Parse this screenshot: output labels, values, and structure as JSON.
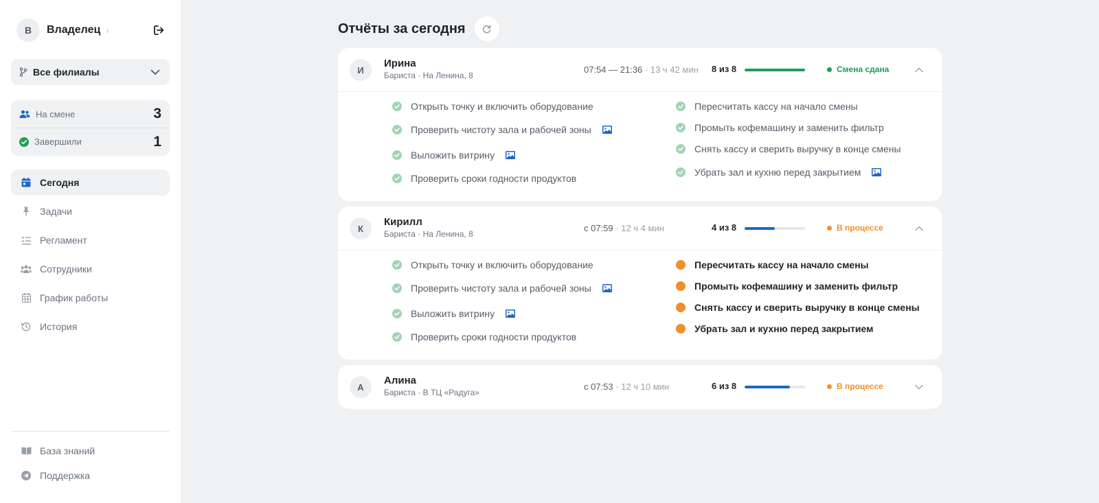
{
  "user": {
    "initial": "В",
    "name": "Владелец"
  },
  "branch": {
    "label": "Все филиалы"
  },
  "stats": [
    {
      "label": "На смене",
      "value": "3",
      "icon": "users-icon"
    },
    {
      "label": "Завершили",
      "value": "1",
      "icon": "check-circle-icon"
    }
  ],
  "nav": [
    {
      "label": "Сегодня",
      "icon": "calendar-icon",
      "active": true
    },
    {
      "label": "Задачи",
      "icon": "pin-icon",
      "active": false
    },
    {
      "label": "Регламент",
      "icon": "checklist-icon",
      "active": false
    },
    {
      "label": "Сотрудники",
      "icon": "users-icon",
      "active": false
    },
    {
      "label": "График работы",
      "icon": "calendar-grid-icon",
      "active": false
    },
    {
      "label": "История",
      "icon": "history-icon",
      "active": false
    }
  ],
  "nav_bottom": [
    {
      "label": "База знаний",
      "icon": "book-icon"
    },
    {
      "label": "Поддержка",
      "icon": "send-icon"
    }
  ],
  "page": {
    "title": "Отчёты за сегодня"
  },
  "colors": {
    "done": "#1e9e57",
    "in_progress": "#f18f2d",
    "progress_blue": "#1e66c6",
    "photo_icon": "#1e66c6",
    "check_icon": "#a3d3b5"
  },
  "employees": [
    {
      "initial": "И",
      "name": "Ирина",
      "role": "Бариста · На Ленина, 8",
      "time": "07:54 — 21:36",
      "duration": " · 13 ч 42 мин",
      "progress_text": "8 из 8",
      "progress": 1.0,
      "status": "Смена сдана",
      "status_kind": "done",
      "expanded": true,
      "tasks_left": [
        {
          "label": "Открыть точку и включить оборудование",
          "done": true,
          "photo": false
        },
        {
          "label": "Проверить чистоту зала и рабочей зоны",
          "done": true,
          "photo": true
        },
        {
          "label": "Выложить витрину",
          "done": true,
          "photo": true
        },
        {
          "label": "Проверить сроки годности продуктов",
          "done": true,
          "photo": false
        }
      ],
      "tasks_right": [
        {
          "label": "Пересчитать кассу на начало смены",
          "done": true,
          "photo": false
        },
        {
          "label": "Промыть кофемашину и заменить фильтр",
          "done": true,
          "photo": false
        },
        {
          "label": "Снять кассу и сверить выручку в конце смены",
          "done": true,
          "photo": false
        },
        {
          "label": "Убрать зал и кухню перед закрытием",
          "done": true,
          "photo": true
        }
      ]
    },
    {
      "initial": "К",
      "name": "Кирилл",
      "role": "Бариста · На Ленина, 8",
      "time": "с 07:59",
      "duration": " · 12 ч 4 мин",
      "progress_text": "4 из 8",
      "progress": 0.5,
      "status": "В процессе",
      "status_kind": "in_progress",
      "expanded": true,
      "tasks_left": [
        {
          "label": "Открыть точку и включить оборудование",
          "done": true,
          "photo": false
        },
        {
          "label": "Проверить чистоту зала и рабочей зоны",
          "done": true,
          "photo": true
        },
        {
          "label": "Выложить витрину",
          "done": true,
          "photo": true
        },
        {
          "label": "Проверить сроки годности продуктов",
          "done": true,
          "photo": false
        }
      ],
      "tasks_right": [
        {
          "label": "Пересчитать кассу на начало смены",
          "done": false,
          "photo": false
        },
        {
          "label": "Промыть кофемашину и заменить фильтр",
          "done": false,
          "photo": false
        },
        {
          "label": "Снять кассу и сверить выручку в конце смены",
          "done": false,
          "photo": false
        },
        {
          "label": "Убрать зал и кухню перед закрытием",
          "done": false,
          "photo": false
        }
      ]
    },
    {
      "initial": "А",
      "name": "Алина",
      "role": "Бариста · В ТЦ «Радуга»",
      "time": "с 07:53",
      "duration": " · 12 ч 10 мин",
      "progress_text": "6 из 8",
      "progress": 0.75,
      "status": "В процессе",
      "status_kind": "in_progress",
      "expanded": false,
      "tasks_left": [],
      "tasks_right": []
    }
  ]
}
